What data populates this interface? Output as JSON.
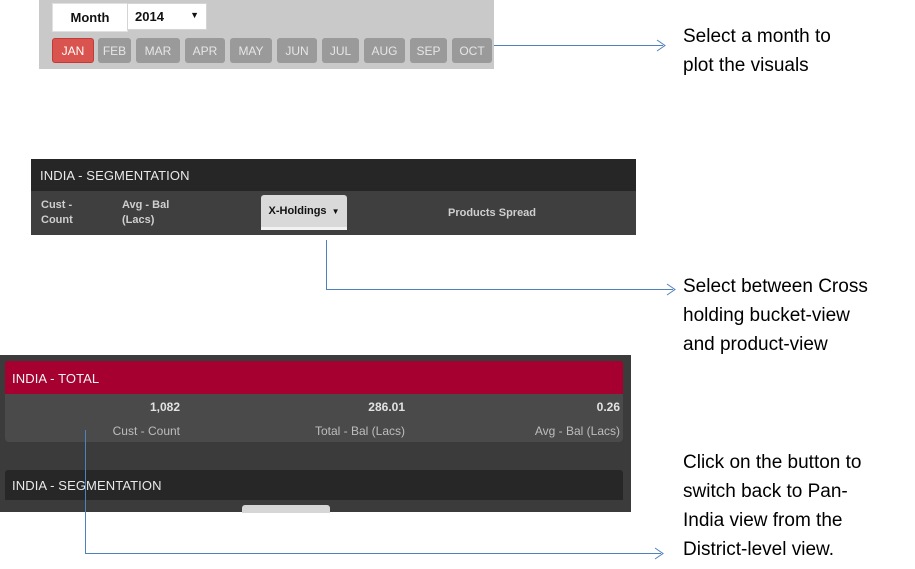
{
  "month_selector": {
    "label": "Month",
    "year": "2014",
    "months": [
      {
        "label": "JAN",
        "active": true
      },
      {
        "label": "FEB",
        "active": false
      },
      {
        "label": "MAR",
        "active": false
      },
      {
        "label": "APR",
        "active": false
      },
      {
        "label": "MAY",
        "active": false
      },
      {
        "label": "JUN",
        "active": false
      },
      {
        "label": "JUL",
        "active": false
      },
      {
        "label": "AUG",
        "active": false
      },
      {
        "label": "SEP",
        "active": false
      },
      {
        "label": "OCT",
        "active": false
      }
    ]
  },
  "segmentation": {
    "title": "INDIA - SEGMENTATION",
    "col_count_l1": "Cust -",
    "col_count_l2": "Count",
    "col_bal_l1": "Avg - Bal",
    "col_bal_l2": "(Lacs)",
    "view_select": "X-Holdings",
    "col_spread": "Products Spread"
  },
  "total": {
    "title": "INDIA - TOTAL",
    "cust_count": "1,082",
    "cust_count_label": "Cust - Count",
    "total_bal": "286.01",
    "total_bal_label": "Total - Bal (Lacs)",
    "avg_bal": "0.26",
    "avg_bal_label": "Avg - Bal (Lacs)"
  },
  "segmentation_lower": {
    "title": "INDIA - SEGMENTATION"
  },
  "annotations": {
    "month_l1": "Select a month to",
    "month_l2": "plot the visuals",
    "view_l1": "Select between Cross",
    "view_l2": "holding bucket-view",
    "view_l3": "and product-view",
    "back_l1": "Click on the button to",
    "back_l2": "switch back to Pan-",
    "back_l3": "India view from the",
    "back_l4": "District-level view."
  },
  "colors": {
    "active_month": "#d9534f",
    "total_header": "#a5002f",
    "connector": "#4f81bd"
  }
}
